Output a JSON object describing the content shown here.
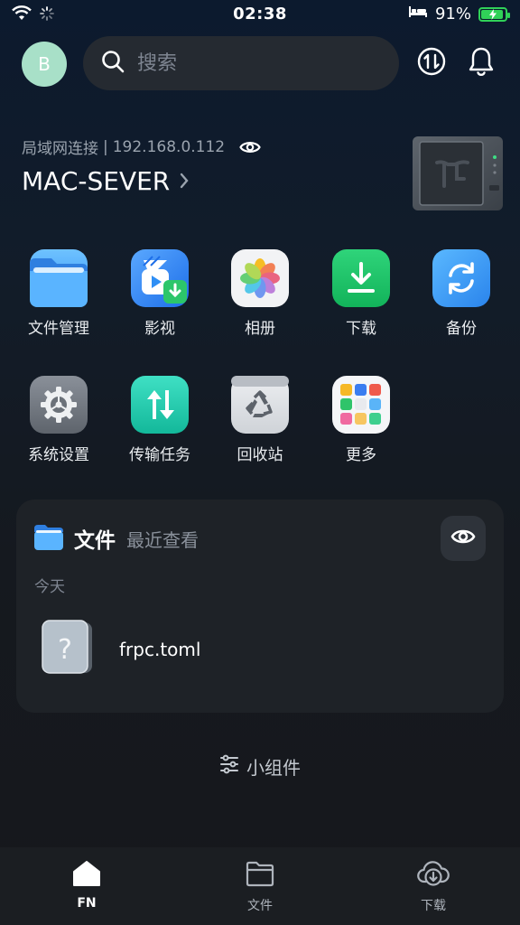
{
  "status_bar": {
    "time": "02:38",
    "battery": "91%",
    "battery_level": 0.91
  },
  "header": {
    "avatar_letter": "B",
    "search_placeholder": "搜索"
  },
  "device": {
    "connection": "局域网连接",
    "ip": "192.168.0.112",
    "separator": "|",
    "name": "MAC-SEVER"
  },
  "apps": [
    {
      "label": "文件管理",
      "icon": "folder-icon"
    },
    {
      "label": "影视",
      "icon": "video-icon"
    },
    {
      "label": "相册",
      "icon": "photos-icon"
    },
    {
      "label": "下载",
      "icon": "download-icon"
    },
    {
      "label": "备份",
      "icon": "backup-icon"
    },
    {
      "label": "系统设置",
      "icon": "settings-icon"
    },
    {
      "label": "传输任务",
      "icon": "transfer-icon"
    },
    {
      "label": "回收站",
      "icon": "recycle-bin-icon"
    },
    {
      "label": "更多",
      "icon": "more-apps-icon"
    }
  ],
  "files_card": {
    "title": "文件",
    "subtitle": "最近查看",
    "section": "今天",
    "items": [
      {
        "name": "frpc.toml",
        "icon": "unknown-file-icon"
      }
    ]
  },
  "widgets_label": "小组件",
  "tabs": [
    {
      "label": "FN",
      "active": true,
      "icon": "home-icon"
    },
    {
      "label": "文件",
      "active": false,
      "icon": "folder-outline-icon"
    },
    {
      "label": "下载",
      "active": false,
      "icon": "cloud-download-icon"
    }
  ]
}
